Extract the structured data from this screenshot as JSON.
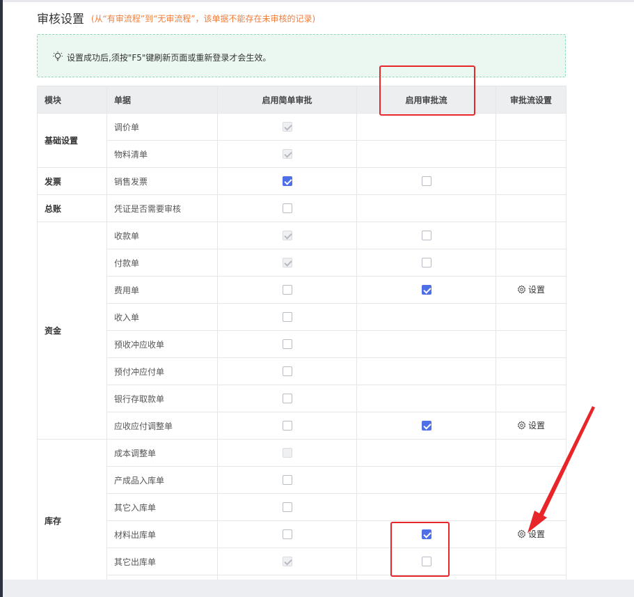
{
  "header": {
    "title": "审核设置",
    "subtitle": "(从“有审流程”到“无审流程”，该单据不能存在未审核的记录)"
  },
  "notice": {
    "text": "设置成功后,须按\"F5\"键刷新页面或重新登录才会生效。"
  },
  "table": {
    "headers": {
      "module": "模块",
      "document": "单据",
      "simple": "启用简单审批",
      "flow": "启用审批流",
      "flow_settings": "审批流设置"
    },
    "setting_label": "设置",
    "groups": [
      {
        "module": "基础设置",
        "rows": [
          {
            "doc": "调价单",
            "simple": "disabled-checked",
            "flow": "none",
            "setting": false
          },
          {
            "doc": "物料清单",
            "simple": "disabled-checked",
            "flow": "none",
            "setting": false
          }
        ]
      },
      {
        "module": "发票",
        "rows": [
          {
            "doc": "销售发票",
            "simple": "checked",
            "flow": "unchecked",
            "setting": false
          }
        ]
      },
      {
        "module": "总账",
        "rows": [
          {
            "doc": "凭证是否需要审核",
            "simple": "unchecked",
            "flow": "none",
            "setting": false
          }
        ]
      },
      {
        "module": "资金",
        "rows": [
          {
            "doc": "收款单",
            "simple": "disabled-checked",
            "flow": "unchecked",
            "setting": false
          },
          {
            "doc": "付款单",
            "simple": "disabled-checked",
            "flow": "unchecked",
            "setting": false
          },
          {
            "doc": "费用单",
            "simple": "unchecked",
            "flow": "checked",
            "setting": true
          },
          {
            "doc": "收入单",
            "simple": "unchecked",
            "flow": "none",
            "setting": false
          },
          {
            "doc": "预收冲应收单",
            "simple": "unchecked",
            "flow": "none",
            "setting": false
          },
          {
            "doc": "预付冲应付单",
            "simple": "unchecked",
            "flow": "none",
            "setting": false
          },
          {
            "doc": "银行存取款单",
            "simple": "unchecked",
            "flow": "none",
            "setting": false
          },
          {
            "doc": "应收应付调整单",
            "simple": "unchecked",
            "flow": "checked",
            "setting": true
          }
        ]
      },
      {
        "module": "库存",
        "rows": [
          {
            "doc": "成本调整单",
            "simple": "disabled",
            "flow": "none",
            "setting": false
          },
          {
            "doc": "产成品入库单",
            "simple": "unchecked",
            "flow": "none",
            "setting": false
          },
          {
            "doc": "其它入库单",
            "simple": "unchecked",
            "flow": "none",
            "setting": false
          },
          {
            "doc": "材料出库单",
            "simple": "unchecked",
            "flow": "checked",
            "setting": true
          },
          {
            "doc": "其它出库单",
            "simple": "disabled-checked",
            "flow": "unchecked",
            "setting": false
          },
          {
            "doc": "",
            "simple": "none",
            "flow": "none",
            "setting": false
          }
        ]
      }
    ]
  },
  "colors": {
    "accent": "#4f6fe6",
    "subtitle": "#f07e3b",
    "annotation": "#e8262a",
    "notice_bg": "#ebf8f1"
  },
  "icons": {
    "notice": "lightbulb-icon",
    "setting": "gear-icon",
    "checkbox": "checkbox-icon"
  }
}
